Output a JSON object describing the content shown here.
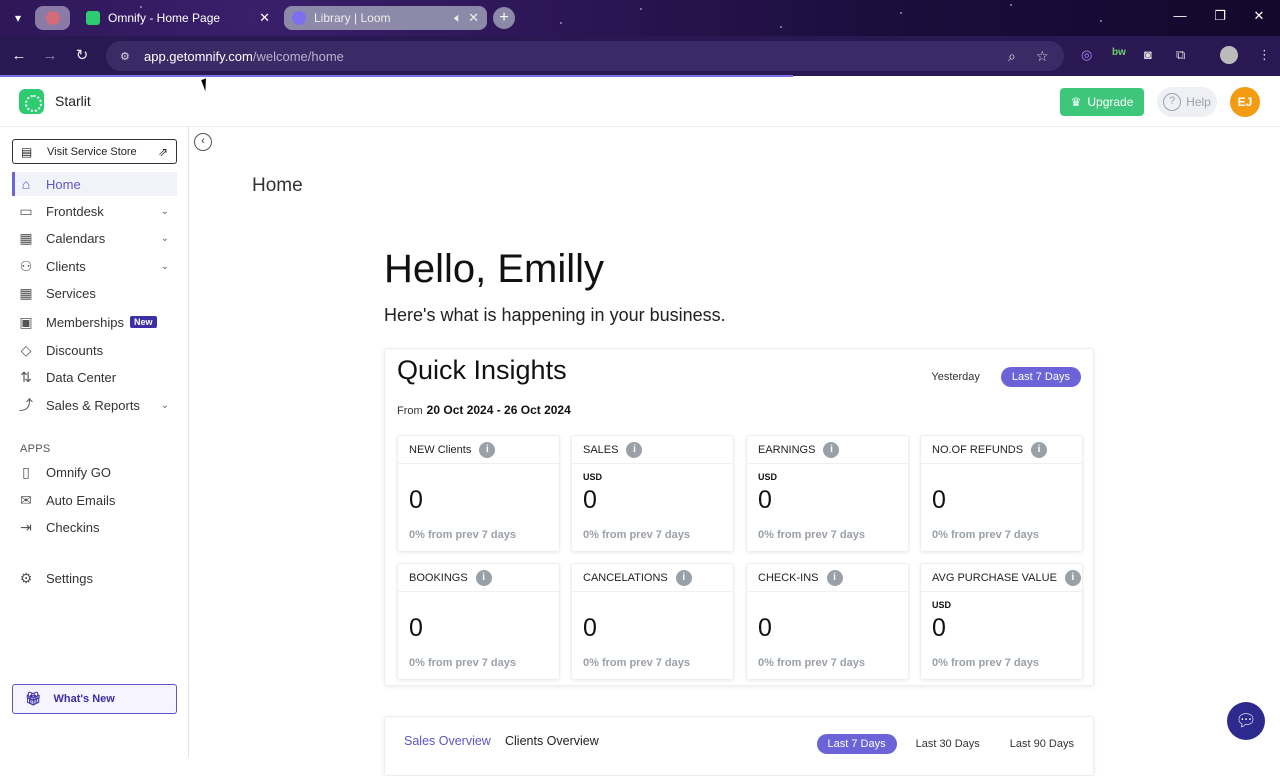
{
  "browser": {
    "tabs": [
      {
        "title": "",
        "pinned": true
      },
      {
        "title": "Omnify - Home Page",
        "active": true
      },
      {
        "title": "Library | Loom",
        "active": false
      }
    ],
    "url_host": "app.getomnify.com",
    "url_path": "/welcome/home"
  },
  "header": {
    "brand": "Starlit",
    "upgrade_label": "Upgrade",
    "help_label": "Help",
    "avatar_initials": "EJ"
  },
  "sidebar": {
    "store_button": "Visit Service Store",
    "items": [
      {
        "label": "Home",
        "icon": "home-icon",
        "active": true
      },
      {
        "label": "Frontdesk",
        "icon": "monitor-icon",
        "expandable": true
      },
      {
        "label": "Calendars",
        "icon": "calendar-icon",
        "expandable": true
      },
      {
        "label": "Clients",
        "icon": "users-icon",
        "expandable": true
      },
      {
        "label": "Services",
        "icon": "grid-icon"
      },
      {
        "label": "Memberships",
        "icon": "membership-icon",
        "badge": "New"
      },
      {
        "label": "Discounts",
        "icon": "tag-icon"
      },
      {
        "label": "Data Center",
        "icon": "transfer-icon"
      },
      {
        "label": "Sales & Reports",
        "icon": "chart-icon",
        "expandable": true
      }
    ],
    "apps_label": "APPS",
    "apps": [
      {
        "label": "Omnify GO",
        "icon": "mobile-icon"
      },
      {
        "label": "Auto Emails",
        "icon": "mail-icon"
      },
      {
        "label": "Checkins",
        "icon": "login-icon"
      }
    ],
    "settings_label": "Settings",
    "whats_new": "What's New"
  },
  "main": {
    "page_title": "Home",
    "greeting": "Hello, Emilly",
    "subtitle": "Here's what is happening in your business.",
    "insights": {
      "title": "Quick Insights",
      "ranges": [
        "Yesterday",
        "Last 7 Days"
      ],
      "selected_range": "Last 7 Days",
      "from_label": "From",
      "date_range": "20 Oct 2024 - 26 Oct 2024",
      "cards": [
        {
          "title": "NEW Clients",
          "currency": "",
          "value": "0",
          "delta": "0% from prev 7 days"
        },
        {
          "title": "SALES",
          "currency": "USD",
          "value": "0",
          "delta": "0% from prev 7 days"
        },
        {
          "title": "EARNINGS",
          "currency": "USD",
          "value": "0",
          "delta": "0% from prev 7 days"
        },
        {
          "title": "NO.OF REFUNDS",
          "currency": "",
          "value": "0",
          "delta": "0% from prev 7 days"
        },
        {
          "title": "BOOKINGS",
          "currency": "",
          "value": "0",
          "delta": "0% from prev 7 days"
        },
        {
          "title": "CANCELATIONS",
          "currency": "",
          "value": "0",
          "delta": "0% from prev 7 days"
        },
        {
          "title": "CHECK-INS",
          "currency": "",
          "value": "0",
          "delta": "0% from prev 7 days"
        },
        {
          "title": "AVG PURCHASE VALUE",
          "currency": "USD",
          "value": "0",
          "delta": "0% from prev 7 days"
        }
      ]
    },
    "overview": {
      "tabs": [
        "Sales Overview",
        "Clients Overview"
      ],
      "ranges": [
        "Last 7 Days",
        "Last 30 Days",
        "Last 90 Days"
      ]
    }
  },
  "colors": {
    "accent": "#6c63d9",
    "upgrade": "#3ec77b",
    "avatar": "#f39c12",
    "chat": "#2d2a8e"
  }
}
